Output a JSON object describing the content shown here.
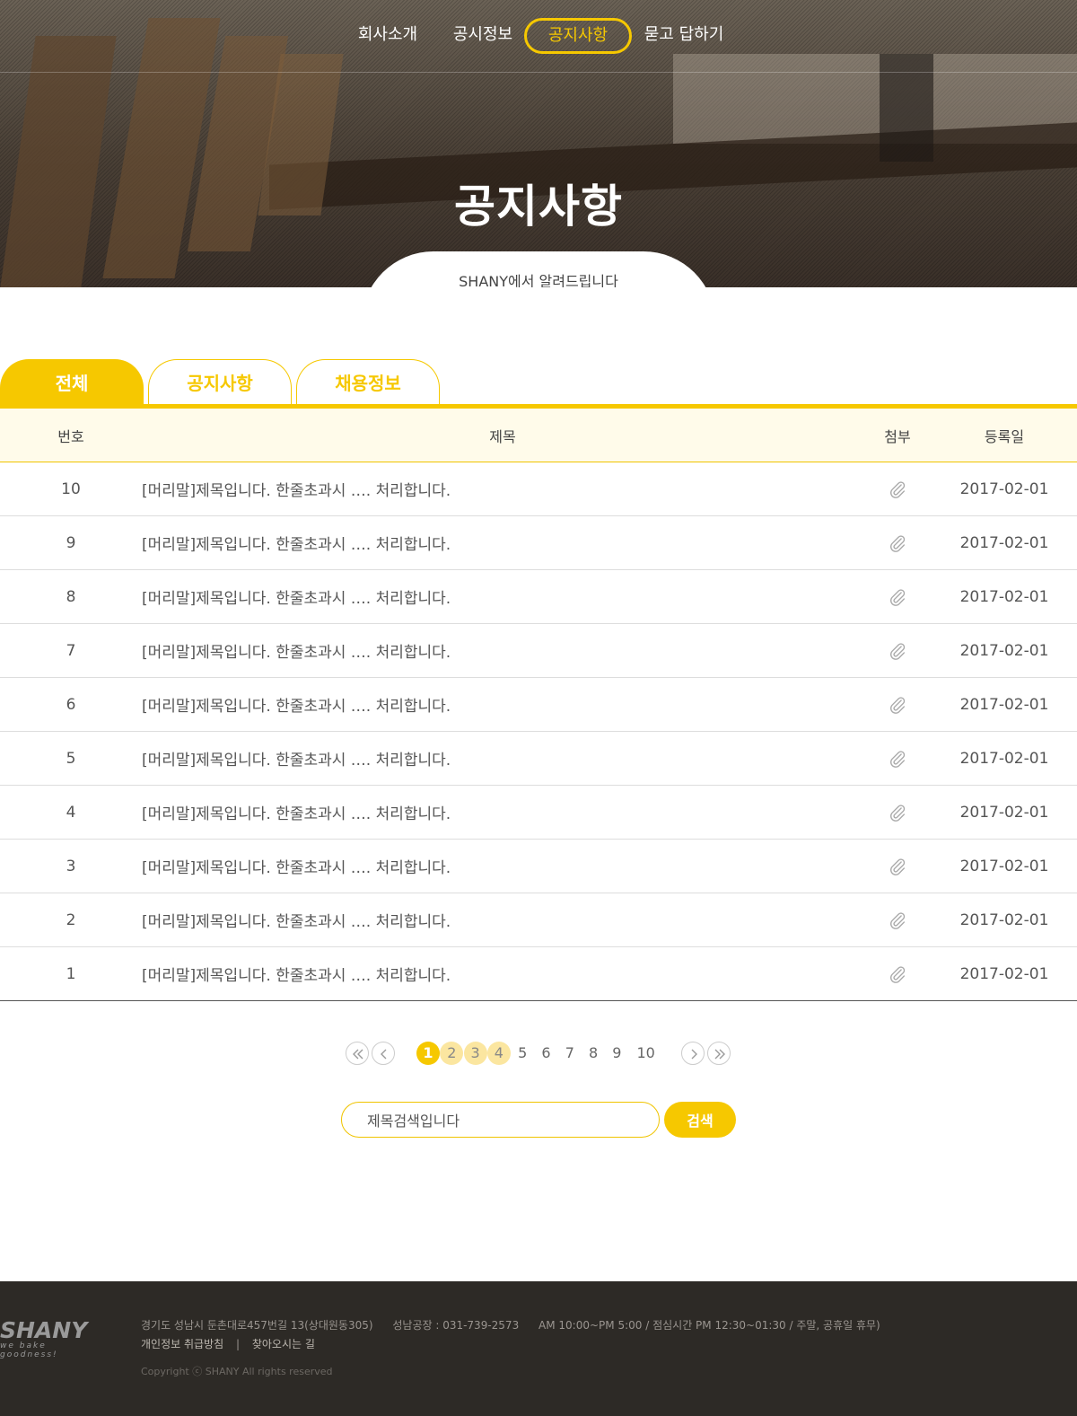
{
  "nav": {
    "items": [
      "회사소개",
      "공시정보",
      "공지사항",
      "묻고 답하기"
    ],
    "active_index": 2
  },
  "hero": {
    "title": "공지사항",
    "subtitle": "SHANY에서 알려드립니다"
  },
  "tabs": [
    "전체",
    "공지사항",
    "채용정보"
  ],
  "table": {
    "headers": [
      "번호",
      "제목",
      "첨부",
      "등록일"
    ],
    "rows": [
      {
        "no": "10",
        "title": "[머리말]제목입니다. 한줄초과시 …. 처리합니다.",
        "date": "2017-02-01"
      },
      {
        "no": "9",
        "title": "[머리말]제목입니다. 한줄초과시 …. 처리합니다.",
        "date": "2017-02-01"
      },
      {
        "no": "8",
        "title": "[머리말]제목입니다. 한줄초과시 …. 처리합니다.",
        "date": "2017-02-01"
      },
      {
        "no": "7",
        "title": "[머리말]제목입니다. 한줄초과시 …. 처리합니다.",
        "date": "2017-02-01"
      },
      {
        "no": "6",
        "title": "[머리말]제목입니다. 한줄초과시 …. 처리합니다.",
        "date": "2017-02-01"
      },
      {
        "no": "5",
        "title": "[머리말]제목입니다. 한줄초과시 …. 처리합니다.",
        "date": "2017-02-01"
      },
      {
        "no": "4",
        "title": "[머리말]제목입니다. 한줄초과시 …. 처리합니다.",
        "date": "2017-02-01"
      },
      {
        "no": "3",
        "title": "[머리말]제목입니다. 한줄초과시 …. 처리합니다.",
        "date": "2017-02-01"
      },
      {
        "no": "2",
        "title": "[머리말]제목입니다. 한줄초과시 …. 처리합니다.",
        "date": "2017-02-01"
      },
      {
        "no": "1",
        "title": "[머리말]제목입니다. 한줄초과시 …. 처리합니다.",
        "date": "2017-02-01"
      }
    ]
  },
  "pagination": {
    "pages": [
      "1",
      "2",
      "3",
      "4",
      "5",
      "6",
      "7",
      "8",
      "9",
      "10"
    ],
    "current": "1"
  },
  "search": {
    "value": "제목검색입니다",
    "button_label": "검색"
  },
  "footer": {
    "logo": "SHANY",
    "logo_tagline": "we bake goodness!",
    "address": "경기도 성남시 둔촌대로457번길 13(상대원동305)",
    "factory": "성남공장 : 031-739-2573",
    "hours": "AM 10:00~PM 5:00 / 점심시간 PM 12:30~01:30 / 주말, 공휴일 휴무)",
    "privacy_link": "개인정보 취급방침",
    "separator": "|",
    "directions_link": "찾아오시는 길",
    "copyright": "Copyright ⓒ SHANY All rights reserved"
  },
  "colors": {
    "accent": "#f6c800",
    "footer_bg": "#2d2a26",
    "header_row_bg": "#fffbea"
  }
}
